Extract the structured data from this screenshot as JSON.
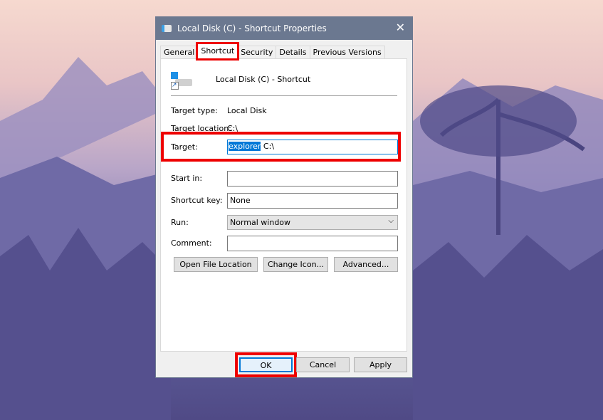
{
  "window": {
    "title": "Local Disk (C) - Shortcut Properties",
    "close_icon": "close-icon"
  },
  "tabs": [
    {
      "label": "General"
    },
    {
      "label": "Shortcut",
      "active": true
    },
    {
      "label": "Security"
    },
    {
      "label": "Details"
    },
    {
      "label": "Previous Versions"
    }
  ],
  "shortcut": {
    "name": "Local Disk (C) - Shortcut",
    "target_type_label": "Target type:",
    "target_type": "Local Disk",
    "target_location_label": "Target location:",
    "target_location": "C:\\",
    "target_label": "Target:",
    "target_selected": "explorer",
    "target_rest": " C:\\",
    "start_in_label": "Start in:",
    "start_in": "",
    "shortcut_key_label": "Shortcut key:",
    "shortcut_key": "None",
    "run_label": "Run:",
    "run": "Normal window",
    "comment_label": "Comment:",
    "comment": "",
    "open_file_location": "Open File Location",
    "change_icon": "Change Icon...",
    "advanced": "Advanced..."
  },
  "footer": {
    "ok": "OK",
    "cancel": "Cancel",
    "apply": "Apply"
  },
  "colors": {
    "highlight": "#e00000",
    "selection": "#0078d7",
    "titlebar": "#6b7890"
  }
}
